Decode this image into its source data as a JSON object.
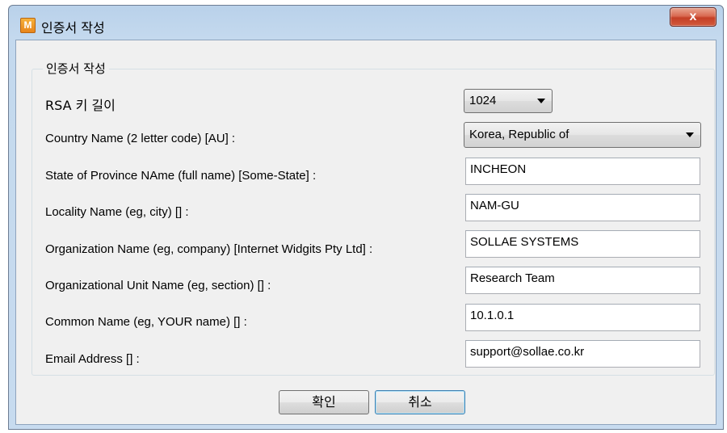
{
  "window": {
    "title": "인증서 작성",
    "app_icon": "M",
    "close_glyph": "x"
  },
  "group": {
    "label": "인증서 작성"
  },
  "fields": {
    "rsa": {
      "label": "RSA 키 길이",
      "value": "1024"
    },
    "country": {
      "label": "Country Name (2 letter code) [AU] :",
      "value": "Korea, Republic of"
    },
    "state": {
      "label": "State of Province NAme (full name) [Some-State] :",
      "value": "INCHEON"
    },
    "locality": {
      "label": "Locality Name (eg, city) [] :",
      "value": "NAM-GU"
    },
    "organization": {
      "label": "Organization Name (eg, company) [Internet Widgits Pty Ltd] :",
      "value": "SOLLAE SYSTEMS"
    },
    "org_unit": {
      "label": "Organizational Unit Name (eg, section) [] :",
      "value": "Research Team"
    },
    "common_name": {
      "label": "Common Name (eg, YOUR name) [] :",
      "value": "10.1.0.1"
    },
    "email": {
      "label": "Email Address [] :",
      "value": "support@sollae.co.kr"
    }
  },
  "buttons": {
    "ok": "확인",
    "cancel": "취소"
  }
}
